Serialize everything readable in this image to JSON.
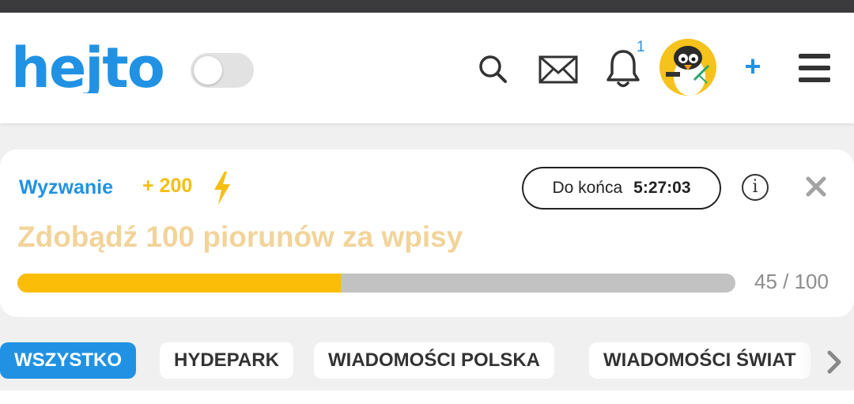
{
  "header": {
    "logo_text": "hejto",
    "notifications_count": "1",
    "plus_label": "+",
    "icons": [
      "search-icon",
      "mail-icon",
      "bell-icon",
      "avatar",
      "hamburger-menu-icon"
    ],
    "theme_toggle_on": false
  },
  "challenge": {
    "label": "Wyzwanie",
    "points": "+ 200",
    "timer_label": "Do końca",
    "timer_value": "5:27:03",
    "title": "Zdobądź 100 piorunów za wpisy",
    "progress_current": 45,
    "progress_total": 100,
    "progress_text": "45 / 100",
    "info_label": "i"
  },
  "categories": [
    {
      "label": "WSZYSTKO",
      "active": true
    },
    {
      "label": "HYDEPARK",
      "active": false
    },
    {
      "label": "WIADOMOŚCI POLSKA",
      "active": false
    },
    {
      "label": "WIADOMOŚCI ŚWIAT",
      "active": false
    }
  ],
  "colors": {
    "accent": "#2192e3",
    "points": "#f6be14",
    "title": "#f2d49a",
    "progress_fill": "#fbbd08",
    "progress_track": "#c2c2c2"
  }
}
